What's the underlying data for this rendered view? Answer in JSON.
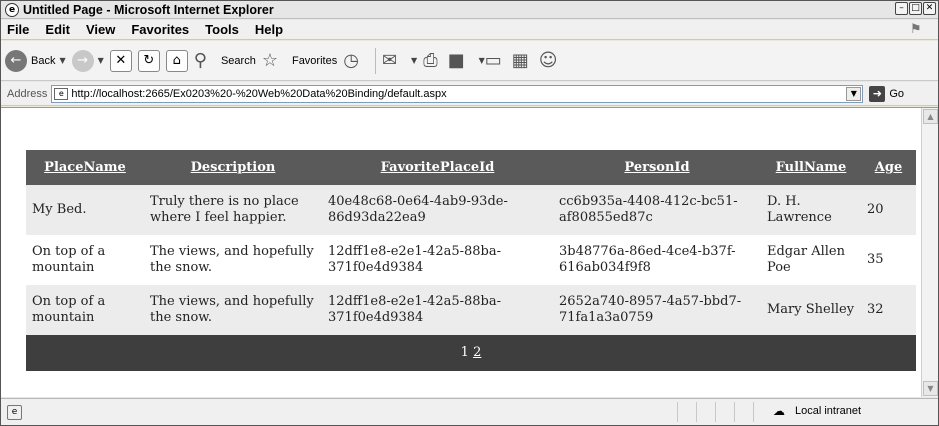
{
  "window": {
    "title": "Untitled Page - Microsoft Internet Explorer",
    "controls": [
      "minimize",
      "maximize",
      "close"
    ]
  },
  "menubar": {
    "items": [
      "File",
      "Edit",
      "View",
      "Favorites",
      "Tools",
      "Help"
    ]
  },
  "toolbar": {
    "back_label": "Back",
    "search_label": "Search",
    "favorites_label": "Favorites"
  },
  "address": {
    "label": "Address",
    "url": "http://localhost:2665/Ex0203%20-%20Web%20Data%20Binding/default.aspx",
    "go_label": "Go"
  },
  "grid": {
    "columns": [
      "PlaceName",
      "Description",
      "FavoritePlaceId",
      "PersonId",
      "FullName",
      "Age"
    ],
    "rows": [
      {
        "place_name": "My Bed.",
        "description": "Truly there is no place where I feel happier.",
        "favorite_place_id": "40e48c68-0e64-4ab9-93de-86d93da22ea9",
        "person_id": "cc6b935a-4408-412c-bc51-af80855ed87c",
        "full_name": "D. H. Lawrence",
        "age": "20"
      },
      {
        "place_name": "On top of a mountain",
        "description": "The views, and hopefully the snow.",
        "favorite_place_id": "12dff1e8-e2e1-42a5-88ba-371f0e4d9384",
        "person_id": "3b48776a-86ed-4ce4-b37f-616ab034f9f8",
        "full_name": "Edgar Allen Poe",
        "age": "35"
      },
      {
        "place_name": "On top of a mountain",
        "description": "The views, and hopefully the snow.",
        "favorite_place_id": "12dff1e8-e2e1-42a5-88ba-371f0e4d9384",
        "person_id": "2652a740-8957-4a57-bbd7-71fa1a3a0759",
        "full_name": "Mary Shelley",
        "age": "32"
      }
    ],
    "pager": {
      "current_page": "1",
      "other_page": "2"
    }
  },
  "status": {
    "zone": "Local intranet"
  },
  "colors": {
    "header_bg": "#5a5a5a",
    "pager_bg": "#3e3e3e",
    "alt_row_bg": "#ececec"
  }
}
